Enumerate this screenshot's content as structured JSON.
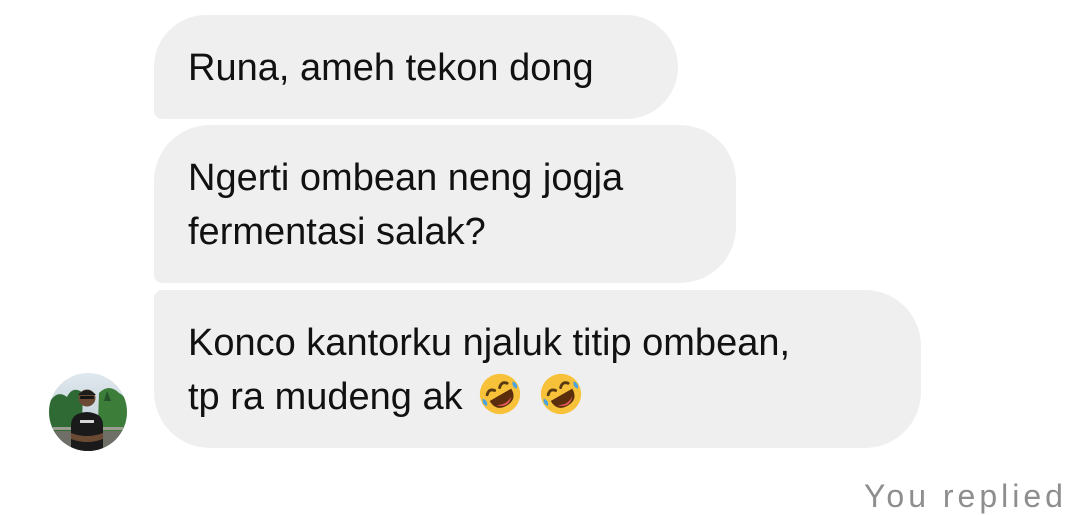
{
  "messages": [
    {
      "lines": [
        "Runa, ameh tekon dong"
      ]
    },
    {
      "lines": [
        "Ngerti ombean neng jogja",
        "fermentasi salak?"
      ]
    },
    {
      "lines": [
        "Konco kantorku njaluk titip ombean,",
        "tp ra mudeng ak"
      ],
      "emojis": [
        "rolling-on-floor-laughing",
        "rolling-on-floor-laughing"
      ]
    }
  ],
  "avatar": {
    "icon": "user-avatar-photo"
  },
  "footer": {
    "text": "You replied"
  },
  "colors": {
    "bubble": "#efefef",
    "text": "#111111",
    "meta": "#8e8e8e",
    "emoji": "#f7c23a"
  }
}
